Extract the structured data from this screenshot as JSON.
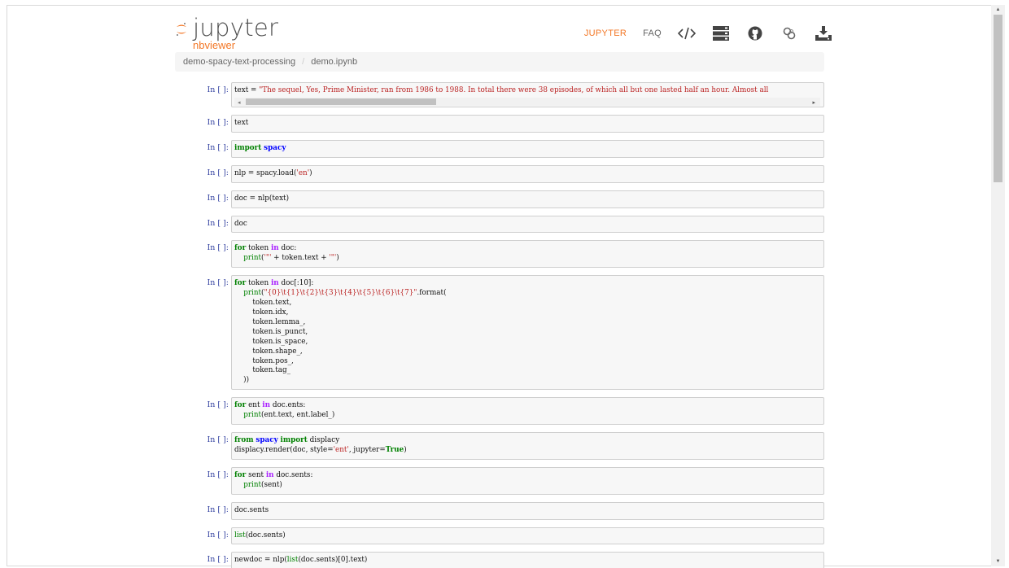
{
  "logo": {
    "word": "jupyter",
    "sub": "nbviewer"
  },
  "nav": {
    "jupyter": "JUPYTER",
    "faq": "FAQ",
    "icons": [
      "code-icon",
      "server-icon",
      "github-icon",
      "binder-icon",
      "download-icon"
    ]
  },
  "breadcrumb": {
    "repo": "demo-spacy-text-processing",
    "file": "demo.ipynb"
  },
  "cells": [
    {
      "prompt": "In [ ]:"
    },
    {
      "prompt": "In [ ]:",
      "text": "text"
    },
    {
      "prompt": "In [ ]:"
    },
    {
      "prompt": "In [ ]:"
    },
    {
      "prompt": "In [ ]:",
      "text": "doc = nlp(text)"
    },
    {
      "prompt": "In [ ]:",
      "text": "doc"
    },
    {
      "prompt": "In [ ]:"
    },
    {
      "prompt": "In [ ]:"
    },
    {
      "prompt": "In [ ]:"
    },
    {
      "prompt": "In [ ]:"
    },
    {
      "prompt": "In [ ]:"
    },
    {
      "prompt": "In [ ]:",
      "text": "doc.sents"
    },
    {
      "prompt": "In [ ]:"
    },
    {
      "prompt": "In [ ]:"
    }
  ],
  "code": {
    "c1": "\"The sequel, Yes, Prime Minister, ran from 1986 to 1988. In total there were 38 episodes, of which all but one lasted half an hour. Almost all",
    "c4_str": "'en'",
    "c7_q1": "'\"'",
    "c7_q2": "'\"'",
    "c8_fmt": "\"{0}\\t{1}\\t{2}\\t{3}\\t{4}\\t{5}\\t{6}\\t{7}\"",
    "c8_args": [
      "token.text,",
      "token.idx,",
      "token.lemma_,",
      "token.is_punct,",
      "token.is_space,",
      "token.shape_,",
      "token.pos_,",
      "token.tag_"
    ],
    "c10_style": "'ent'",
    "c14_tail": "(doc.sents)[0].text)"
  },
  "colors": {
    "accent": "#f37726",
    "prompt": "#303f9f",
    "keyword": "#008000",
    "string": "#ba2121"
  }
}
